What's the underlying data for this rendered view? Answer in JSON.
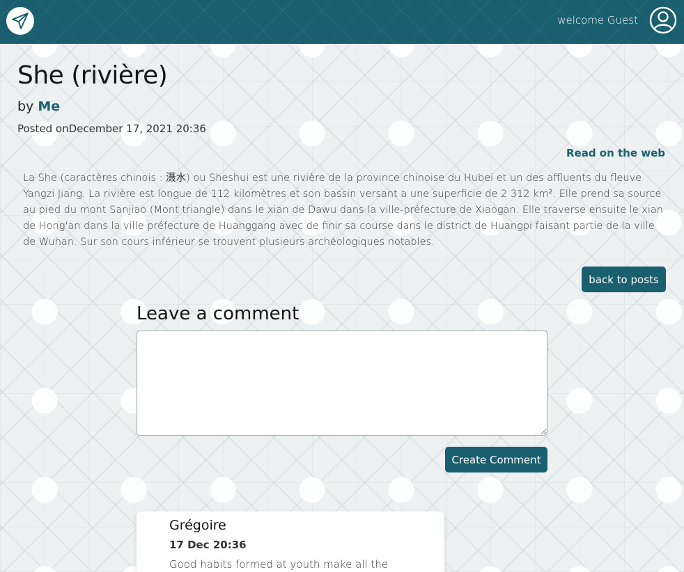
{
  "header": {
    "welcome": "welcome Guest",
    "logo_icon": "paper-plane-icon",
    "user_icon": "user-circle-icon",
    "brand_color": "#195f6f"
  },
  "post": {
    "title": "She (rivière)",
    "by_label": "by",
    "author": "Me",
    "posted_label": "Posted on",
    "posted_date": "December 17, 2021 20:36",
    "read_web": "Read on the web",
    "body": "La She (caractères chinois : 滠水) ou Sheshui est une rivière de la province chinoise du Hubei et un des affluents du fleuve Yangzi Jiang. La rivière est longue de 112 kilomètres et son bassin versant a une superficie de 2 312 km². Elle prend sa source au pied du mont Sanjiao (Mont triangle) dans le xian de Dawu dans la ville-préfecture de Xiaogan. Elle traverse ensuite le xian de Hong'an dans la ville préfecture de Huanggang avec de finir sa course dans le district de Huangpi faisant partie de la ville de Wuhan. Sur son cours inférieur se trouvent plusieurs archéologiques notables.",
    "back_label": "back to posts"
  },
  "comment_form": {
    "heading": "Leave a comment",
    "value": "",
    "submit_label": "Create Comment"
  },
  "comments": [
    {
      "author": "Grégoire",
      "date": "17 Dec 20:36",
      "text": "Good habits formed at youth make all the"
    }
  ]
}
